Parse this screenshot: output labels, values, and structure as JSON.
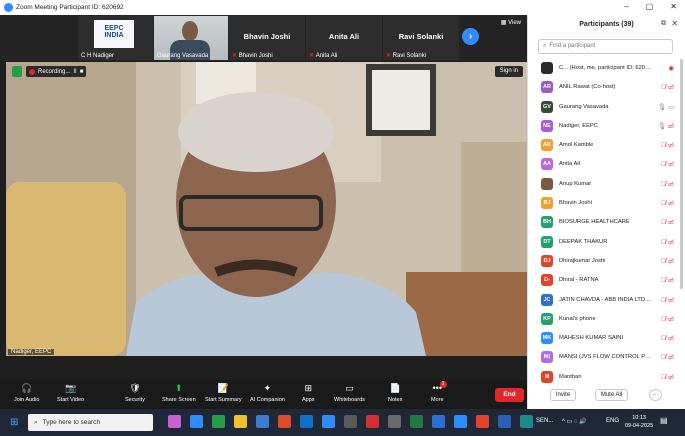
{
  "window": {
    "title": "Zoom Meeting Participant ID: 620692",
    "controls": [
      "–",
      "▢",
      "✕"
    ]
  },
  "thumbnails": [
    {
      "name": "C H Nadiger",
      "muted": false,
      "logo_text": "EEPC INDIA"
    },
    {
      "name": "Gaurang Vasavada",
      "muted": false
    },
    {
      "name": "Bhavin Joshi",
      "muted": true,
      "center_name": "Bhavin Joshi"
    },
    {
      "name": "Anita Ali",
      "muted": true,
      "center_name": "Anita Ali"
    },
    {
      "name": "Ravi Solanki",
      "muted": true,
      "center_name": "Ravi Solanki"
    }
  ],
  "view_label": "View",
  "main_video": {
    "recording_label": "Recording...",
    "pause_glyph": "II",
    "stop_glyph": "■",
    "signin_label": "Sign in",
    "speaker_name": "Nadiger, EEPC"
  },
  "toolbar": {
    "items": [
      {
        "label": "Join Audio",
        "icon": "🎧"
      },
      {
        "label": "Start Video",
        "icon": "📷"
      },
      {
        "label": "Security",
        "icon": "🛡"
      },
      {
        "label": "Share Screen",
        "icon": "⬆"
      },
      {
        "label": "Start Summary",
        "icon": "📝"
      },
      {
        "label": "AI Companion",
        "icon": "✦"
      },
      {
        "label": "Apps",
        "icon": "⊞"
      },
      {
        "label": "Whiteboards",
        "icon": "▭"
      },
      {
        "label": "Notes",
        "icon": "📄"
      },
      {
        "label": "More",
        "icon": "•••"
      }
    ],
    "more_badge": "1",
    "end_label": "End"
  },
  "participants_panel": {
    "title": "Participants (39)",
    "search_placeholder": "Find a participant",
    "invite_label": "Invite",
    "mute_all_label": "Mute All",
    "more_label": "···",
    "participants": [
      {
        "initials": "",
        "name": "C... (Host, me, participant ID: 620692)",
        "color": "#2b2b2b",
        "status": "host"
      },
      {
        "initials": "AR",
        "name": "ANIL Rawat (Co-host)",
        "color": "#9b59d0",
        "status": "muted"
      },
      {
        "initials": "GV",
        "name": "Gaurang Vasavada",
        "color": "#3a4a3a",
        "status": "unmuted"
      },
      {
        "initials": "NE",
        "name": "Nadiger, EEPC",
        "color": "#a95cd6",
        "status": "speaking"
      },
      {
        "initials": "AK",
        "name": "Amol Kamble",
        "color": "#f0a030",
        "status": "muted"
      },
      {
        "initials": "AA",
        "name": "Anita Ali",
        "color": "#b46ae0",
        "status": "muted"
      },
      {
        "initials": "",
        "name": "Anup Kumar",
        "color": "#7a5a44",
        "status": "muted"
      },
      {
        "initials": "BJ",
        "name": "Bhavin Joshi",
        "color": "#f0a030",
        "status": "muted"
      },
      {
        "initials": "BH",
        "name": "BIOSURGE HEALTHCARE",
        "color": "#23a071",
        "status": "muted"
      },
      {
        "initials": "DT",
        "name": "DEEPAK THAKUR",
        "color": "#23a071",
        "status": "muted"
      },
      {
        "initials": "DJ",
        "name": "Dhirajkumar Joshi",
        "color": "#e0452a",
        "status": "muted"
      },
      {
        "initials": "D-",
        "name": "Dhiral - RATNA",
        "color": "#e0452a",
        "status": "muted"
      },
      {
        "initials": "JC",
        "name": "JATIN CHAVDA - ABB INDIA LTD....",
        "color": "#2d6fd0",
        "status": "muted"
      },
      {
        "initials": "KP",
        "name": "Kunal's phone",
        "color": "#23a071",
        "status": "muted"
      },
      {
        "initials": "MK",
        "name": "MAHESH KUMAR SAINI",
        "color": "#2d8cff",
        "status": "muted"
      },
      {
        "initials": "M(",
        "name": "MANSI (JVS FLOW CONTROL PVT L...",
        "color": "#b46ae0",
        "status": "muted"
      },
      {
        "initials": "M",
        "name": "Manthan",
        "color": "#e0452a",
        "status": "muted"
      }
    ]
  },
  "taskbar": {
    "search_placeholder": "Type here to search",
    "tray_app": "SEN...",
    "tray_lang": "ENG",
    "time": "10:13",
    "date": "09-04-2025",
    "colors": {
      "accent": "#2d8cff",
      "end": "#e02828",
      "share_green": "#23c552"
    }
  }
}
